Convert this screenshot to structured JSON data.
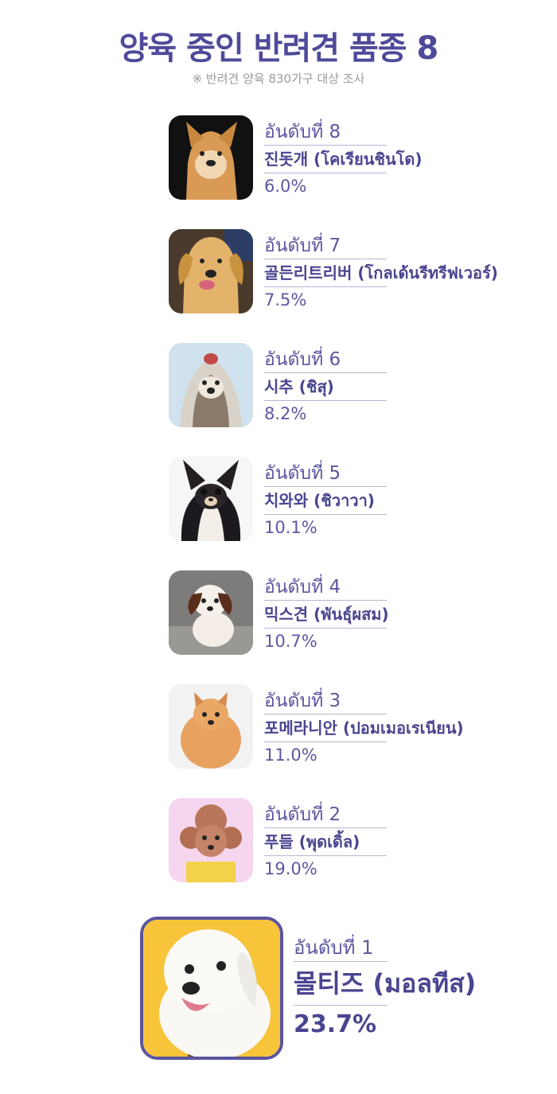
{
  "header": {
    "title": "양육 중인 반려견 품종 8",
    "subtitle": "※ 반려견 양육 830가구 대상 조사"
  },
  "items": [
    {
      "rank": "อันดับที่ 8",
      "name": "진돗개 (โคเรียนชินโด)",
      "percent": "6.0%",
      "icon": "jindo-dog-photo",
      "bg": "#111111"
    },
    {
      "rank": "อันดับที่ 7",
      "name": "골든리트리버 (โกลเด้นรีทรีฟเวอร์)",
      "percent": "7.5%",
      "icon": "golden-retriever-photo",
      "bg": "#4a3a2c"
    },
    {
      "rank": "อันดับที่ 6",
      "name": "시추 (ชิสุ)",
      "percent": "8.2%",
      "icon": "shih-tzu-photo",
      "bg": "#cfe2ee"
    },
    {
      "rank": "อันดับที่ 5",
      "name": "치와와 (ชิวาวา)",
      "percent": "10.1%",
      "icon": "chihuahua-photo",
      "bg": "#f6f6f6"
    },
    {
      "rank": "อันดับที่ 4",
      "name": "믹스견 (พันธุ์ผสม)",
      "percent": "10.7%",
      "icon": "mixed-breed-puppy-photo",
      "bg": "#7d7c7a"
    },
    {
      "rank": "อันดับที่ 3",
      "name": "포메라니안 (ปอมเมอเรเนียน)",
      "percent": "11.0%",
      "icon": "pomeranian-photo",
      "bg": "#f2f2f2"
    },
    {
      "rank": "อันดับที่ 2",
      "name": "푸들 (พุดเดิ้ล)",
      "percent": "19.0%",
      "icon": "poodle-photo",
      "bg": "#f6d6ee"
    }
  ],
  "first": {
    "rank": "อันดับที่ 1",
    "name": "몰티즈 (มอลทีส)",
    "percent": "23.7%",
    "icon": "maltese-photo",
    "bg": "#f7c43a"
  }
}
